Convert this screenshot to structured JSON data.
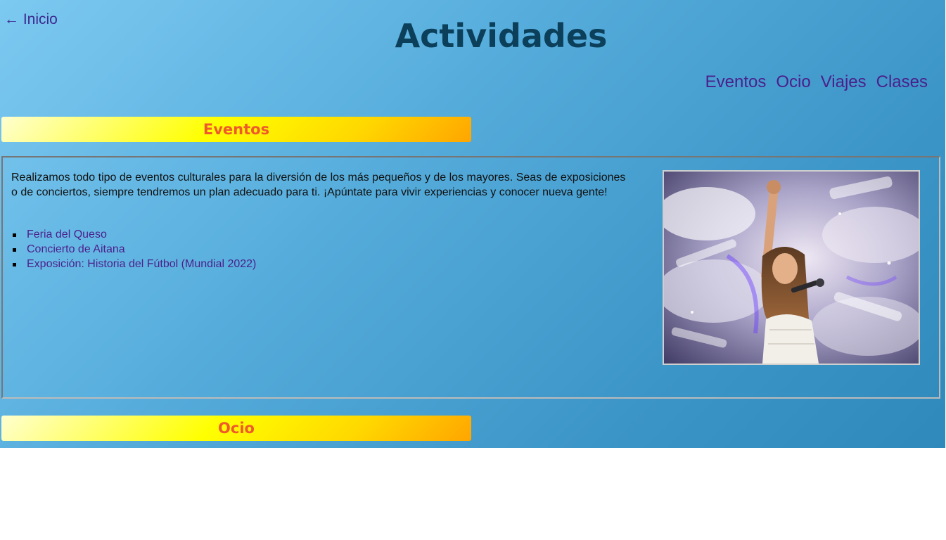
{
  "header": {
    "back_link": "← Inicio",
    "title": "Actividades"
  },
  "nav": {
    "items": [
      "Eventos",
      "Ocio",
      "Viajes",
      "Clases"
    ]
  },
  "sections": [
    {
      "title": "Eventos",
      "description": "Realizamos todo tipo de eventos culturales para la diversión de los más pequeños y de los mayores. Seas de exposiciones o de conciertos, siempre tendremos un plan adecuado para ti. ¡Apúntate para vivir experiencias y conocer nueva gente!",
      "links": [
        "Feria del Queso",
        "Concierto de Aitana",
        "Exposición: Historia del Fútbol (Mundial 2022)"
      ]
    },
    {
      "title": "Ocio"
    }
  ],
  "colors": {
    "title": "#0c3f5a",
    "link": "#4b1f8c",
    "section_title": "#ef5a2a",
    "background_light": "#7cc9f1",
    "background_dark": "#2f89bb"
  }
}
